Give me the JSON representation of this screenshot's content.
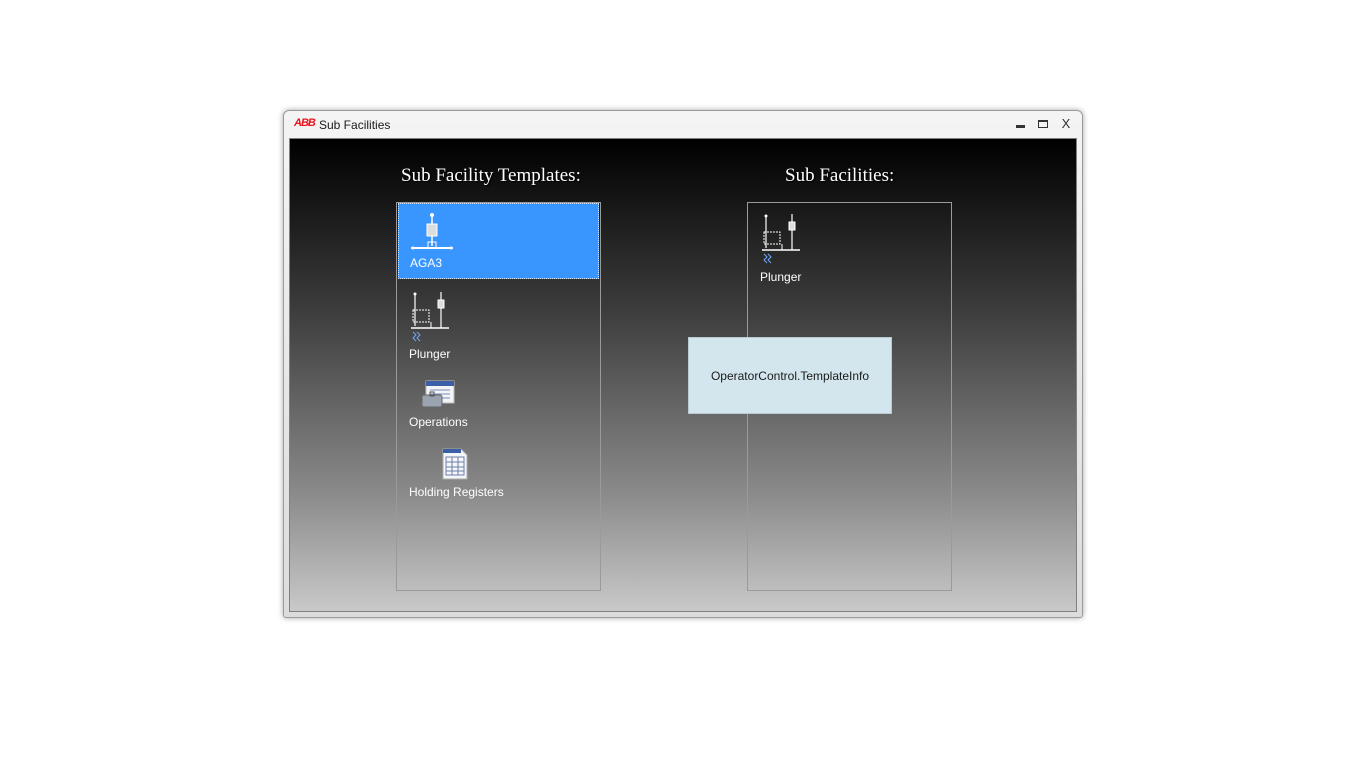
{
  "window": {
    "title": "Sub Facilities",
    "logo_text": "ABB",
    "controls": {
      "close": "X"
    }
  },
  "templates": {
    "heading": "Sub Facility Templates:",
    "items": [
      {
        "label": "AGA3",
        "icon": "aga3-meter-icon",
        "selected": true
      },
      {
        "label": "Plunger",
        "icon": "plunger-lift-icon",
        "selected": false
      },
      {
        "label": "Operations",
        "icon": "operations-icon",
        "selected": false
      },
      {
        "label": "Holding Registers",
        "icon": "holding-registers-icon",
        "selected": false
      }
    ]
  },
  "sub_facilities": {
    "heading": "Sub Facilities:",
    "items": [
      {
        "label": "Plunger",
        "icon": "plunger-lift-icon"
      }
    ]
  },
  "drag_tooltip": {
    "text": "OperatorControl.TemplateInfo"
  },
  "colors": {
    "selection": "#3a96ff",
    "tooltip_bg": "#d3e6ee",
    "logo": "#e8141c"
  }
}
